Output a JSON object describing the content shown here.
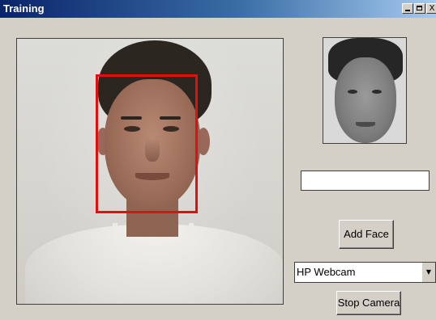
{
  "window": {
    "title": "Training",
    "minimize_glyph": "",
    "maximize_glyph": "",
    "close_glyph": "X"
  },
  "camera": {
    "detection_color": "#e01010"
  },
  "form": {
    "name_value": "",
    "add_face_label": "Add Face",
    "camera_selected": "HP Webcam",
    "stop_camera_label": "Stop Camera"
  },
  "colors": {
    "titlebar_start": "#0a246a",
    "titlebar_end": "#a6caf0",
    "face": "#d4d0c8"
  }
}
